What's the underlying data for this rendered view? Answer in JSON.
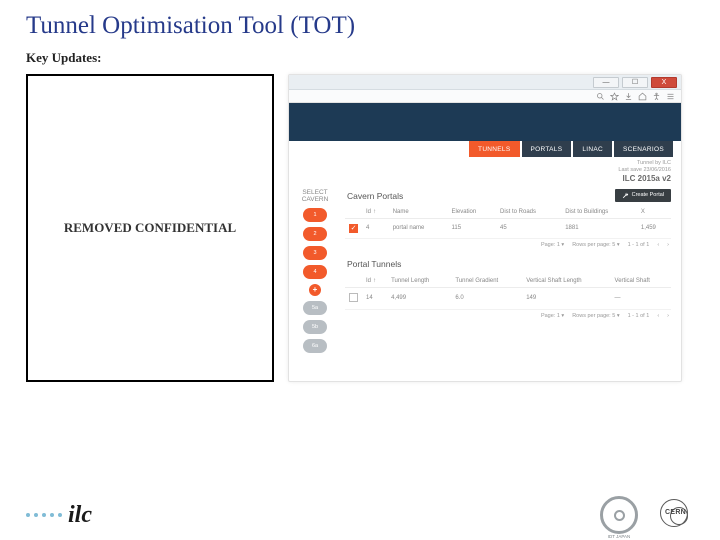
{
  "slide": {
    "title": "Tunnel Optimisation Tool (TOT)",
    "subhead": "Key Updates:",
    "redacted": "REMOVED CONFIDENTIAL"
  },
  "app": {
    "window": {
      "min": "—",
      "max": "☐",
      "close": "X"
    },
    "tabs": [
      {
        "label": "TUNNELS",
        "active": true
      },
      {
        "label": "PORTALS",
        "active": false
      },
      {
        "label": "LINAC",
        "active": false
      },
      {
        "label": "SCENARIOS",
        "active": false
      }
    ],
    "meta": {
      "tool": "Tunnel by ILC",
      "saved": "Last save 23/06/2016",
      "project": "ILC 2015a v2"
    },
    "select": {
      "label": "SELECT CAVERN",
      "chips": [
        "1",
        "2",
        "3",
        "4"
      ],
      "plus": "+",
      "more": [
        "5a",
        "5b",
        "6a"
      ]
    },
    "portals": {
      "title": "Cavern Portals",
      "toolbtn": "Create Portal",
      "cols": [
        "Id",
        "Name",
        "Elevation",
        "Dist to Roads",
        "Dist to Buildings",
        "X"
      ],
      "row": {
        "checked": true,
        "id": "4",
        "name": "portal name",
        "elev": "115",
        "roads": "45",
        "buildings": "1881",
        "x": "1,459"
      },
      "pager": {
        "page": "Page:  1 ▾",
        "rpp": "Rows per page:  5 ▾",
        "range": "1 - 1 of 1",
        "prev": "‹",
        "next": "›"
      }
    },
    "tunnels": {
      "title": "Portal Tunnels",
      "cols": [
        "Id",
        "Tunnel Length",
        "Tunnel Gradient",
        "Vertical Shaft Length",
        "Vertical Shaft"
      ],
      "row": {
        "checked": false,
        "id": "14",
        "len": "4,499",
        "grad": "6.0",
        "vshaft": "149",
        "vshaft2": "—"
      },
      "pager": {
        "page": "Page:  1 ▾",
        "rpp": "Rows per page:  5 ▾",
        "range": "1 - 1 of 1",
        "prev": "‹",
        "next": "›"
      }
    }
  },
  "footer": {
    "ilc": "ilc",
    "logo1": "IDT JAPAN",
    "logo2": "CERN"
  }
}
